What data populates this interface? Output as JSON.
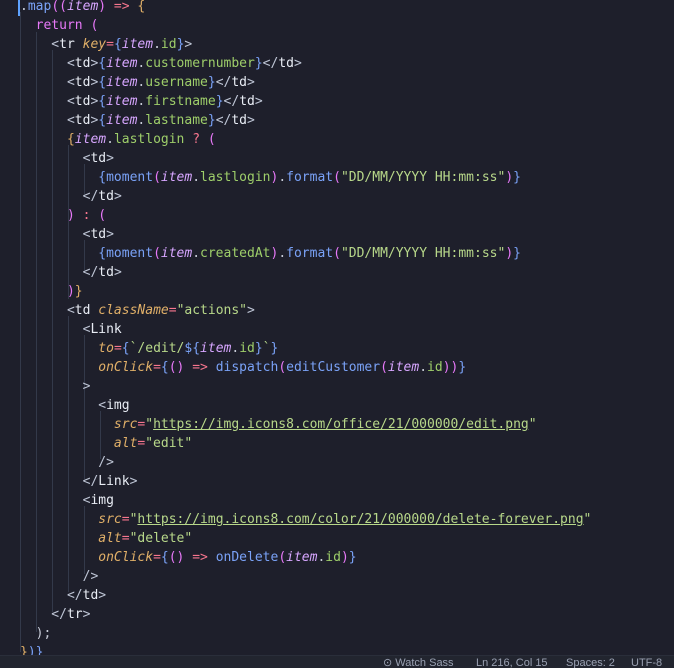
{
  "editor": {
    "lines": [
      [
        [
          ".",
          "pl"
        ],
        [
          "map",
          "fn"
        ],
        [
          "((",
          "par"
        ],
        [
          "item",
          "var"
        ],
        [
          ")",
          "par"
        ],
        [
          " => ",
          "op"
        ],
        [
          "{",
          "pb"
        ]
      ],
      [
        [
          "  return ",
          "kw"
        ],
        [
          "(",
          "par"
        ]
      ],
      [
        [
          "    <",
          "tag"
        ],
        [
          "tr ",
          "jsx"
        ],
        [
          "key",
          "attr"
        ],
        [
          "=",
          "op"
        ],
        [
          "{",
          "br"
        ],
        [
          "item",
          "var"
        ],
        [
          ".",
          "pl"
        ],
        [
          "id",
          "prop"
        ],
        [
          "}",
          "br"
        ],
        [
          ">",
          "tag"
        ]
      ],
      [
        [
          "      <",
          "tag"
        ],
        [
          "td",
          "jsx"
        ],
        [
          ">",
          "tag"
        ],
        [
          "{",
          "br"
        ],
        [
          "item",
          "var"
        ],
        [
          ".",
          "pl"
        ],
        [
          "customernumber",
          "prop"
        ],
        [
          "}",
          "br"
        ],
        [
          "</",
          "tag"
        ],
        [
          "td",
          "jsx"
        ],
        [
          ">",
          "tag"
        ]
      ],
      [
        [
          "      <",
          "tag"
        ],
        [
          "td",
          "jsx"
        ],
        [
          ">",
          "tag"
        ],
        [
          "{",
          "br"
        ],
        [
          "item",
          "var"
        ],
        [
          ".",
          "pl"
        ],
        [
          "username",
          "prop"
        ],
        [
          "}",
          "br"
        ],
        [
          "</",
          "tag"
        ],
        [
          "td",
          "jsx"
        ],
        [
          ">",
          "tag"
        ]
      ],
      [
        [
          "      <",
          "tag"
        ],
        [
          "td",
          "jsx"
        ],
        [
          ">",
          "tag"
        ],
        [
          "{",
          "br"
        ],
        [
          "item",
          "var"
        ],
        [
          ".",
          "pl"
        ],
        [
          "firstname",
          "prop"
        ],
        [
          "}",
          "br"
        ],
        [
          "</",
          "tag"
        ],
        [
          "td",
          "jsx"
        ],
        [
          ">",
          "tag"
        ]
      ],
      [
        [
          "      <",
          "tag"
        ],
        [
          "td",
          "jsx"
        ],
        [
          ">",
          "tag"
        ],
        [
          "{",
          "br"
        ],
        [
          "item",
          "var"
        ],
        [
          ".",
          "pl"
        ],
        [
          "lastname",
          "prop"
        ],
        [
          "}",
          "br"
        ],
        [
          "</",
          "tag"
        ],
        [
          "td",
          "jsx"
        ],
        [
          ">",
          "tag"
        ]
      ],
      [
        [
          "      ",
          "pl"
        ],
        [
          "{",
          "pb"
        ],
        [
          "item",
          "var"
        ],
        [
          ".",
          "pl"
        ],
        [
          "lastlogin",
          "prop"
        ],
        [
          " ? ",
          "op"
        ],
        [
          "(",
          "par"
        ]
      ],
      [
        [
          "        <",
          "tag"
        ],
        [
          "td",
          "jsx"
        ],
        [
          ">",
          "tag"
        ]
      ],
      [
        [
          "          {",
          "br"
        ],
        [
          "moment",
          "fn"
        ],
        [
          "(",
          "par"
        ],
        [
          "item",
          "var"
        ],
        [
          ".",
          "pl"
        ],
        [
          "lastlogin",
          "prop"
        ],
        [
          ")",
          "par"
        ],
        [
          ".",
          "pl"
        ],
        [
          "format",
          "fn"
        ],
        [
          "(",
          "par"
        ],
        [
          "\"DD/MM/YYYY HH:mm:ss\"",
          "str"
        ],
        [
          ")",
          "par"
        ],
        [
          "}",
          "br"
        ]
      ],
      [
        [
          "        </",
          "tag"
        ],
        [
          "td",
          "jsx"
        ],
        [
          ">",
          "tag"
        ]
      ],
      [
        [
          "      ",
          "pl"
        ],
        [
          ")",
          "par"
        ],
        [
          " : ",
          "op"
        ],
        [
          "(",
          "par"
        ]
      ],
      [
        [
          "        <",
          "tag"
        ],
        [
          "td",
          "jsx"
        ],
        [
          ">",
          "tag"
        ]
      ],
      [
        [
          "          {",
          "br"
        ],
        [
          "moment",
          "fn"
        ],
        [
          "(",
          "par"
        ],
        [
          "item",
          "var"
        ],
        [
          ".",
          "pl"
        ],
        [
          "createdAt",
          "prop"
        ],
        [
          ")",
          "par"
        ],
        [
          ".",
          "pl"
        ],
        [
          "format",
          "fn"
        ],
        [
          "(",
          "par"
        ],
        [
          "\"DD/MM/YYYY HH:mm:ss\"",
          "str"
        ],
        [
          ")",
          "par"
        ],
        [
          "}",
          "br"
        ]
      ],
      [
        [
          "        </",
          "tag"
        ],
        [
          "td",
          "jsx"
        ],
        [
          ">",
          "tag"
        ]
      ],
      [
        [
          "      ",
          "pl"
        ],
        [
          ")",
          "par"
        ],
        [
          "}",
          "pb"
        ]
      ],
      [
        [
          "      <",
          "tag"
        ],
        [
          "td ",
          "jsx"
        ],
        [
          "className",
          "attr"
        ],
        [
          "=",
          "op"
        ],
        [
          "\"actions\"",
          "str"
        ],
        [
          ">",
          "tag"
        ]
      ],
      [
        [
          "        <",
          "tag"
        ],
        [
          "Link",
          "jsx"
        ]
      ],
      [
        [
          "          ",
          "pl"
        ],
        [
          "to",
          "attr"
        ],
        [
          "=",
          "op"
        ],
        [
          "{",
          "br"
        ],
        [
          "`/edit/",
          "str"
        ],
        [
          "${",
          "br"
        ],
        [
          "item",
          "var"
        ],
        [
          ".",
          "pl"
        ],
        [
          "id",
          "prop"
        ],
        [
          "}",
          "br"
        ],
        [
          "`",
          "str"
        ],
        [
          "}",
          "br"
        ]
      ],
      [
        [
          "          ",
          "pl"
        ],
        [
          "onClick",
          "attr"
        ],
        [
          "=",
          "op"
        ],
        [
          "{",
          "br"
        ],
        [
          "()",
          "par"
        ],
        [
          " => ",
          "op"
        ],
        [
          "dispatch",
          "fn"
        ],
        [
          "(",
          "par"
        ],
        [
          "editCustomer",
          "fn"
        ],
        [
          "(",
          "par"
        ],
        [
          "item",
          "var"
        ],
        [
          ".",
          "pl"
        ],
        [
          "id",
          "prop"
        ],
        [
          "))",
          "par"
        ],
        [
          "}",
          "br"
        ]
      ],
      [
        [
          "        >",
          "tag"
        ]
      ],
      [
        [
          "          <",
          "tag"
        ],
        [
          "img",
          "jsx"
        ]
      ],
      [
        [
          "            ",
          "pl"
        ],
        [
          "src",
          "attr"
        ],
        [
          "=",
          "op"
        ],
        [
          "\"",
          "str"
        ],
        [
          "https://img.icons8.com/office/21/000000/edit.png",
          "url"
        ],
        [
          "\"",
          "str"
        ]
      ],
      [
        [
          "            ",
          "pl"
        ],
        [
          "alt",
          "attr"
        ],
        [
          "=",
          "op"
        ],
        [
          "\"edit\"",
          "str"
        ]
      ],
      [
        [
          "          />",
          "tag"
        ]
      ],
      [
        [
          "        </",
          "tag"
        ],
        [
          "Link",
          "jsx"
        ],
        [
          ">",
          "tag"
        ]
      ],
      [
        [
          "        <",
          "tag"
        ],
        [
          "img",
          "jsx"
        ]
      ],
      [
        [
          "          ",
          "pl"
        ],
        [
          "src",
          "attr"
        ],
        [
          "=",
          "op"
        ],
        [
          "\"",
          "str"
        ],
        [
          "https://img.icons8.com/color/21/000000/delete-forever.png",
          "url"
        ],
        [
          "\"",
          "str"
        ]
      ],
      [
        [
          "          ",
          "pl"
        ],
        [
          "alt",
          "attr"
        ],
        [
          "=",
          "op"
        ],
        [
          "\"delete\"",
          "str"
        ]
      ],
      [
        [
          "          ",
          "pl"
        ],
        [
          "onClick",
          "attr"
        ],
        [
          "=",
          "op"
        ],
        [
          "{",
          "br"
        ],
        [
          "()",
          "par"
        ],
        [
          " => ",
          "op"
        ],
        [
          "onDelete",
          "fn"
        ],
        [
          "(",
          "par"
        ],
        [
          "item",
          "var"
        ],
        [
          ".",
          "pl"
        ],
        [
          "id",
          "prop"
        ],
        [
          ")",
          "par"
        ],
        [
          "}",
          "br"
        ]
      ],
      [
        [
          "        />",
          "tag"
        ]
      ],
      [
        [
          "      </",
          "tag"
        ],
        [
          "td",
          "jsx"
        ],
        [
          ">",
          "tag"
        ]
      ],
      [
        [
          "    </",
          "tag"
        ],
        [
          "tr",
          "jsx"
        ],
        [
          ">",
          "tag"
        ]
      ],
      [
        [
          "  );",
          "pl"
        ]
      ],
      [
        [
          "}",
          "pb"
        ],
        [
          ")}",
          "br"
        ]
      ]
    ]
  },
  "statusbar": {
    "watch_sass": "Watch Sass",
    "position": "Ln 216, Col 15",
    "spaces": "Spaces: 2",
    "encoding": "UTF-8"
  }
}
